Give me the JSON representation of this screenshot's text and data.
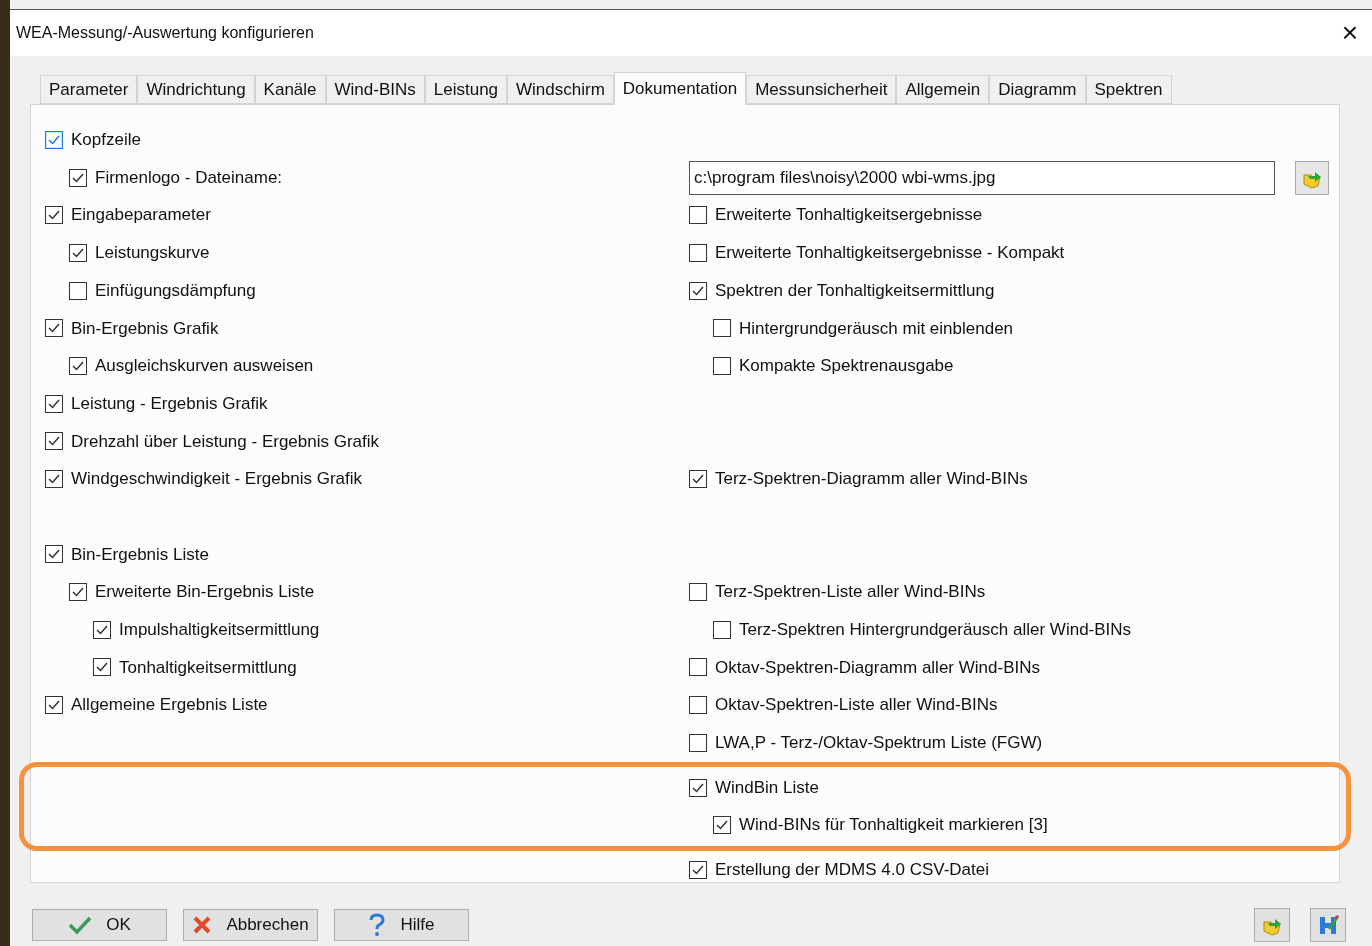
{
  "window": {
    "title": "WEA-Messung/-Auswertung konfigurieren",
    "close": "×"
  },
  "tabs": [
    {
      "label": "Parameter",
      "selected": false
    },
    {
      "label": "Windrichtung",
      "selected": false
    },
    {
      "label": "Kanäle",
      "selected": false
    },
    {
      "label": "Wind-BINs",
      "selected": false
    },
    {
      "label": "Leistung",
      "selected": false
    },
    {
      "label": "Windschirm",
      "selected": false
    },
    {
      "label": "Dokumentation",
      "selected": true
    },
    {
      "label": "Messunsicherheit",
      "selected": false
    },
    {
      "label": "Allgemein",
      "selected": false
    },
    {
      "label": "Diagramm",
      "selected": false
    },
    {
      "label": "Spektren",
      "selected": false
    }
  ],
  "rows": [
    {
      "highlighted": false,
      "left": {
        "kind": "option",
        "label": "Kopfzeile",
        "checked": true,
        "focused": true
      }
    },
    {
      "highlighted": false,
      "left": {
        "kind": "suboption",
        "label": "Firmenlogo - Dateiname:",
        "checked": true,
        "focused": false
      },
      "right": {
        "kind": "file",
        "value": "c:\\program files\\noisy\\2000 wbi-wms.jpg"
      }
    },
    {
      "highlighted": false,
      "left": {
        "kind": "option",
        "label": "Eingabeparameter",
        "checked": true,
        "focused": false
      },
      "right": {
        "kind": "option",
        "label": "Erweiterte Tonhaltigkeitsergebnisse",
        "checked": false,
        "focused": false
      }
    },
    {
      "highlighted": false,
      "left": {
        "kind": "suboption",
        "label": "Leistungskurve",
        "checked": true,
        "focused": false
      },
      "right": {
        "kind": "option",
        "label": "Erweiterte Tonhaltigkeitsergebnisse - Kompakt",
        "checked": false,
        "focused": false
      }
    },
    {
      "highlighted": false,
      "left": {
        "kind": "suboption",
        "label": "Einfügungsdämpfung",
        "checked": false,
        "focused": false
      },
      "right": {
        "kind": "option",
        "label": "Spektren der Tonhaltigkeitsermittlung",
        "checked": true,
        "focused": false
      }
    },
    {
      "highlighted": false,
      "left": {
        "kind": "option",
        "label": "Bin-Ergebnis Grafik",
        "checked": true,
        "focused": false
      },
      "right": {
        "kind": "suboption",
        "label": "Hintergrundgeräusch mit einblenden",
        "checked": false,
        "focused": false
      }
    },
    {
      "highlighted": false,
      "left": {
        "kind": "suboption",
        "label": "Ausgleichskurven ausweisen",
        "checked": true,
        "focused": false
      },
      "right": {
        "kind": "suboption",
        "label": "Kompakte Spektrenausgabe",
        "checked": false,
        "focused": false
      }
    },
    {
      "highlighted": false,
      "left": {
        "kind": "option",
        "label": "Leistung - Ergebnis Grafik",
        "checked": true,
        "focused": false
      }
    },
    {
      "highlighted": false,
      "left": {
        "kind": "option",
        "label": "Drehzahl über Leistung - Ergebnis Grafik",
        "checked": true,
        "focused": false
      }
    },
    {
      "highlighted": false,
      "left": {
        "kind": "option",
        "label": "Windgeschwindigkeit - Ergebnis Grafik",
        "checked": true,
        "focused": false
      },
      "right": {
        "kind": "option",
        "label": "Terz-Spektren-Diagramm aller Wind-BINs",
        "checked": true,
        "focused": false
      }
    },
    {
      "highlighted": false
    },
    {
      "highlighted": false,
      "left": {
        "kind": "option",
        "label": "Bin-Ergebnis Liste",
        "checked": true,
        "focused": false
      }
    },
    {
      "highlighted": false,
      "left": {
        "kind": "suboption",
        "label": "Erweiterte Bin-Ergebnis Liste",
        "checked": true,
        "focused": false
      },
      "right": {
        "kind": "option",
        "label": "Terz-Spektren-Liste aller Wind-BINs",
        "checked": false,
        "focused": false
      }
    },
    {
      "highlighted": false,
      "left": {
        "kind": "subsuboption",
        "label": "Impulshaltigkeitsermittlung",
        "checked": true,
        "focused": false
      },
      "right": {
        "kind": "suboption",
        "label": "Terz-Spektren Hintergrundgeräusch aller Wind-BINs",
        "checked": false,
        "focused": false
      }
    },
    {
      "highlighted": false,
      "left": {
        "kind": "subsuboption",
        "label": "Tonhaltigkeitsermittlung",
        "checked": true,
        "focused": false
      },
      "right": {
        "kind": "option",
        "label": "Oktav-Spektren-Diagramm aller Wind-BINs",
        "checked": false,
        "focused": false
      }
    },
    {
      "highlighted": false,
      "left": {
        "kind": "option",
        "label": "Allgemeine Ergebnis Liste",
        "checked": true,
        "focused": false
      },
      "right": {
        "kind": "option",
        "label": "Oktav-Spektren-Liste aller Wind-BINs",
        "checked": false,
        "focused": false
      }
    },
    {
      "highlighted": false,
      "right": {
        "kind": "option",
        "label": "LWA,P - Terz-/Oktav-Spektrum Liste (FGW)",
        "checked": false,
        "focused": false
      }
    },
    {
      "highlighted": true,
      "right": {
        "kind": "option",
        "label": "WindBin Liste",
        "checked": true,
        "focused": false
      }
    },
    {
      "highlighted": true,
      "right": {
        "kind": "suboption",
        "label": "Wind-BINs für Tonhaltigkeit markieren [3]",
        "checked": true,
        "focused": false
      }
    },
    {
      "highlighted": false,
      "right": {
        "kind": "option",
        "label": "Erstellung der MDMS 4.0 CSV-Datei",
        "checked": true,
        "focused": false
      }
    }
  ],
  "buttons": [
    {
      "kind": "ok",
      "label": "OK"
    },
    {
      "kind": "cancel",
      "label": "Abbrechen"
    },
    {
      "kind": "help",
      "label": "Hilfe"
    }
  ]
}
